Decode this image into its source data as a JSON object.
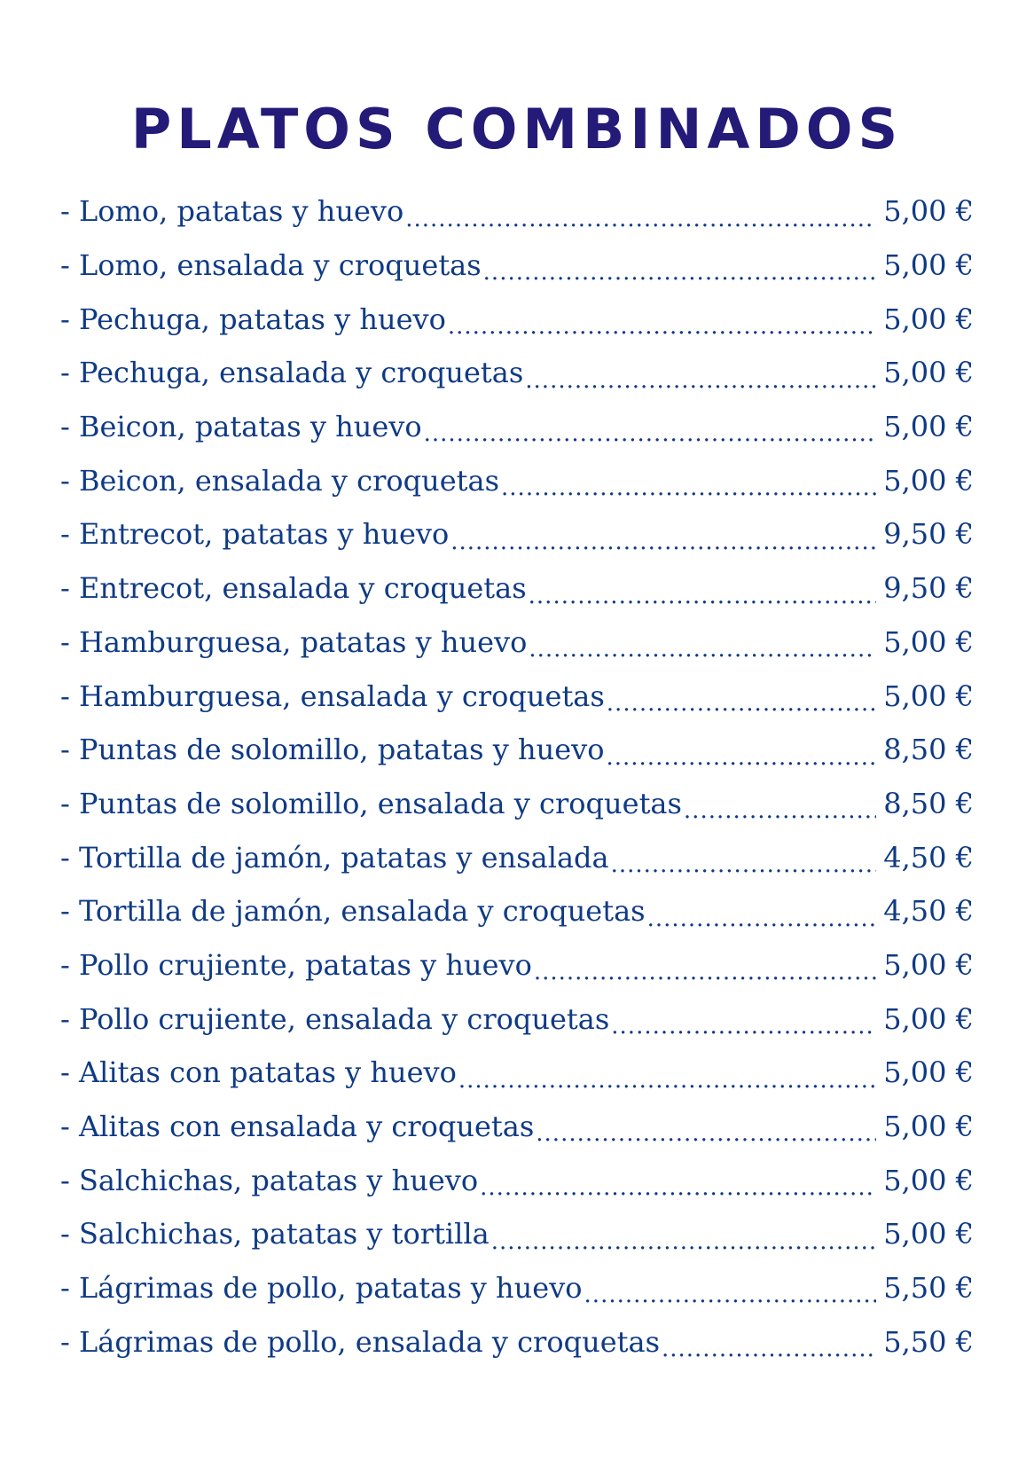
{
  "title": "PLATOS COMBINADOS",
  "items": [
    {
      "name": "- Lomo, patatas y huevo",
      "price": "5,00 €"
    },
    {
      "name": "- Lomo, ensalada y croquetas",
      "price": "5,00 €"
    },
    {
      "name": "- Pechuga, patatas y huevo",
      "price": "5,00 €"
    },
    {
      "name": "- Pechuga, ensalada y croquetas",
      "price": "5,00 €"
    },
    {
      "name": "- Beicon, patatas y huevo",
      "price": "5,00 €"
    },
    {
      "name": "- Beicon, ensalada y croquetas",
      "price": "5,00 €"
    },
    {
      "name": "- Entrecot, patatas y huevo",
      "price": "9,50 €"
    },
    {
      "name": "- Entrecot, ensalada y croquetas",
      "price": "9,50 €"
    },
    {
      "name": "- Hamburguesa, patatas y huevo",
      "price": "5,00 €"
    },
    {
      "name": "- Hamburguesa, ensalada y croquetas",
      "price": "5,00 €"
    },
    {
      "name": "- Puntas de solomillo, patatas y huevo",
      "price": "8,50 €"
    },
    {
      "name": "- Puntas de solomillo, ensalada y croquetas",
      "price": "8,50 €"
    },
    {
      "name": "- Tortilla de jamón, patatas y ensalada",
      "price": "4,50 €"
    },
    {
      "name": "- Tortilla de jamón, ensalada y croquetas",
      "price": "4,50 €"
    },
    {
      "name": "- Pollo crujiente, patatas y huevo",
      "price": "5,00 €"
    },
    {
      "name": "- Pollo crujiente, ensalada y croquetas",
      "price": "5,00 €"
    },
    {
      "name": "- Alitas con patatas y huevo",
      "price": "5,00 €"
    },
    {
      "name": "- Alitas con ensalada y croquetas",
      "price": "5,00 €"
    },
    {
      "name": "- Salchichas, patatas y huevo",
      "price": "5,00 €"
    },
    {
      "name": "- Salchichas, patatas y tortilla",
      "price": "5,00 €"
    },
    {
      "name": "- Lágrimas de pollo, patatas y huevo",
      "price": "5,50 €"
    },
    {
      "name": "- Lágrimas de pollo, ensalada y croquetas",
      "price": "5,50 €"
    }
  ],
  "colors": {
    "title": "#241a78",
    "text": "#0f3a85"
  }
}
